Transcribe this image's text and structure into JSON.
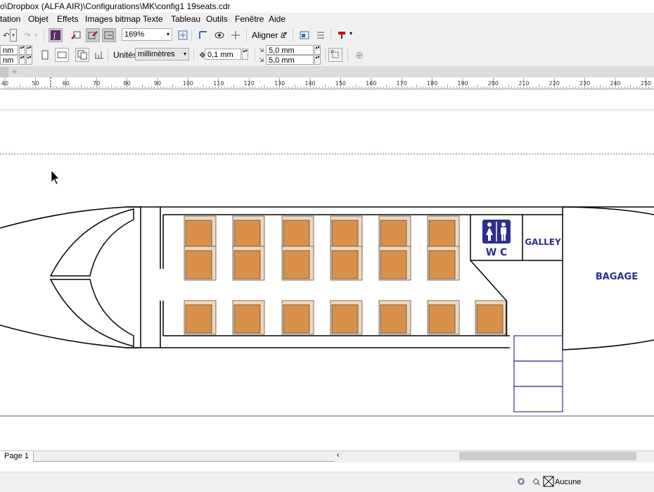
{
  "window": {
    "title": "o\\Dropbox (ALFA AIR)\\Configurations\\MK\\config1 19seats.cdr"
  },
  "menu": {
    "items": [
      "tation",
      "Objet",
      "Effets",
      "Images bitmap",
      "Texte",
      "Tableau",
      "Outils",
      "Fenêtre",
      "Aide"
    ]
  },
  "toolbar": {
    "zoom": "169%",
    "align_label": "Aligner à",
    "units_label": "Unités:",
    "units_value": "millimètres",
    "nudge_value": "0,1 mm",
    "dup_x": "5,0 mm",
    "dup_y": "5,0 mm",
    "pos_x_partial": "nm",
    "pos_y_partial": "nm"
  },
  "ruler": {
    "labels": [
      "40",
      "50",
      "60",
      "70",
      "80",
      "90",
      "100",
      "110",
      "120",
      "130",
      "140",
      "150",
      "160",
      "170",
      "180",
      "190",
      "200",
      "210",
      "220",
      "230",
      "240",
      "250"
    ]
  },
  "drawing": {
    "wc_label": "W C",
    "galley_label": "GALLEY",
    "bagage_label": "BAGAGE",
    "colors": {
      "seat_fill": "#d8904a",
      "seat_edge": "#f0d8b8",
      "label": "#2e2e8e",
      "stairs": "#2f2fb0",
      "guide": "#6060c0"
    }
  },
  "pagebar": {
    "page_tab": "Page 1"
  },
  "status": {
    "fill_label": "Aucune"
  }
}
